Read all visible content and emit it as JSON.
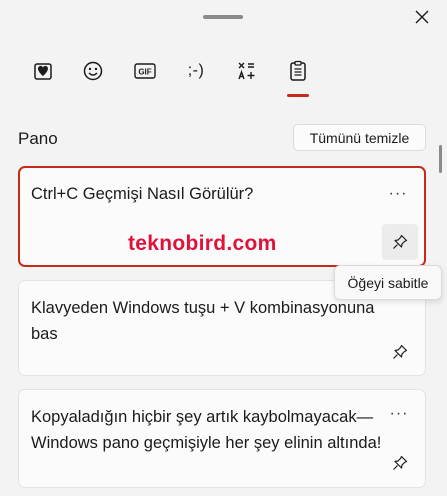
{
  "window": {
    "close_icon": "close-icon"
  },
  "tabs": [
    {
      "id": "favorites",
      "icon": "heart-board-icon"
    },
    {
      "id": "emoji",
      "icon": "smiley-icon"
    },
    {
      "id": "gif",
      "label": "GIF"
    },
    {
      "id": "kaomoji",
      "label": ";-)"
    },
    {
      "id": "symbols",
      "icon": "symbols-icon"
    },
    {
      "id": "clipboard",
      "icon": "clipboard-icon",
      "active": true
    }
  ],
  "clipboard": {
    "title": "Pano",
    "clear_all_label": "Tümünü temizle",
    "items": [
      {
        "text": "Ctrl+C Geçmişi Nasıl Görülür?",
        "selected": true
      },
      {
        "text": "Klavyeden Windows tuşu + V kombinasyonuna bas",
        "selected": false
      },
      {
        "text": "Kopyaladığın hiçbir şey artık kaybolmayacak—Windows pano geçmişiyle her şey elinin altında!",
        "selected": false
      }
    ],
    "more_label": "···"
  },
  "watermark": "teknobird.com",
  "tooltip": "Öğeyi sabitle",
  "colors": {
    "accent": "#c42b1c",
    "watermark": "#e0123a",
    "background": "#f3f3f3",
    "card": "#fbfbfb"
  }
}
